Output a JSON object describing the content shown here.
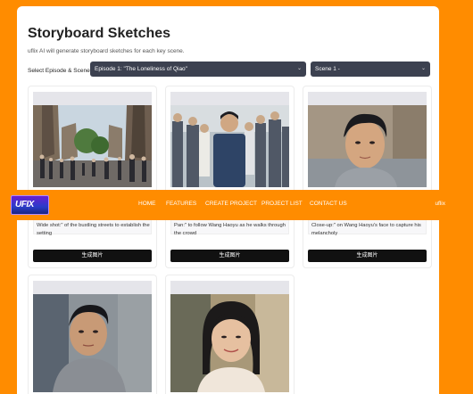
{
  "header": {
    "title": "Storyboard Sketches",
    "subtitle": "uflix AI will generate storyboard sketches for each key scene."
  },
  "selectors": {
    "label": "Select Episode & Scene:",
    "episode": "Episode 1: \"The Loneliness of Qiao\"",
    "scene": "Scene 1 -"
  },
  "navbar": {
    "logo_text": "UFIX",
    "items": [
      "HOME",
      "FEATURES",
      "CREATE PROJECT",
      "PROJECT LIST",
      "CONTACT US"
    ],
    "user": "uflix"
  },
  "cards": [
    {
      "description": "Wide shot:\" of the bustling streets to establish the setting",
      "button": "生成图片",
      "image": "city-street-crowd"
    },
    {
      "description": "Pan:\" to follow Wang Haoyu as he walks through the crowd",
      "button": "生成图片",
      "image": "man-walking-crowd"
    },
    {
      "description": "Close-up:\" on Wang Haoyu's face to capture his melancholy",
      "button": "生成图片",
      "image": "man-closeup"
    },
    {
      "description": "",
      "button": "",
      "image": "man-portrait"
    },
    {
      "description": "",
      "button": "",
      "image": "woman-portrait"
    }
  ],
  "colors": {
    "accent": "#ff8c00",
    "select_bg": "#3c4150",
    "button_bg": "#111111"
  }
}
